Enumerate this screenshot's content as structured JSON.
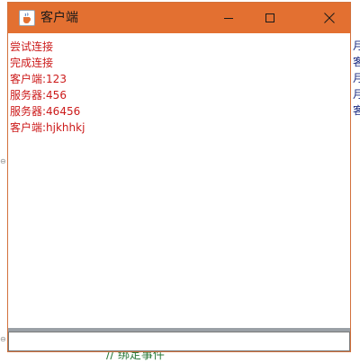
{
  "window": {
    "title": "客户端",
    "title_bar_color": "#e37031",
    "icon": "java-cup-icon",
    "controls": {
      "minimize": "minimize-icon",
      "maximize": "maximize-icon",
      "close": "close-icon"
    }
  },
  "log": {
    "text_color": "#cc1a1a",
    "lines": [
      "尝试连接",
      "完成连接",
      "客户端:123",
      "服务器:456",
      "服务器:46456",
      "客户端:hjkhhkj"
    ]
  },
  "message_input": {
    "value": ""
  },
  "background": {
    "right_fragments": [
      "月",
      "客",
      "月",
      "月",
      "客"
    ],
    "bottom_code": "// 绑定事件"
  }
}
